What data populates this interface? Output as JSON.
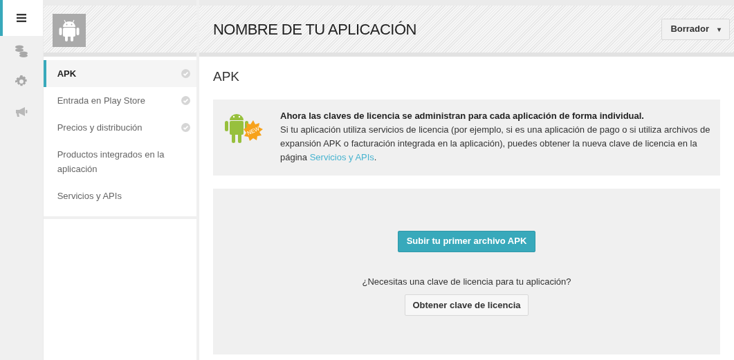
{
  "rail": [
    {
      "selected": true
    },
    {
      "selected": false
    },
    {
      "selected": false
    },
    {
      "selected": false
    }
  ],
  "nav": {
    "items": [
      {
        "label": "APK",
        "selected": true,
        "completed": true
      },
      {
        "label": "Entrada en Play Store",
        "selected": false,
        "completed": true
      },
      {
        "label": "Precios y distribución",
        "selected": false,
        "completed": true
      },
      {
        "label": "Productos integrados en la aplicación",
        "selected": false,
        "completed": false
      },
      {
        "label": "Servicios y APIs",
        "selected": false,
        "completed": false
      }
    ]
  },
  "header": {
    "title": "NOMBRE DE TU APLICACIÓN",
    "status_button": "Borrador",
    "caret": "▾"
  },
  "section_title": "APK",
  "notice": {
    "badge": "NEW",
    "heading": "Ahora las claves de licencia se administran para cada aplicación de forma individual.",
    "body": "Si tu aplicación utiliza servicios de licencia (por ejemplo, si es una aplicación de pago o si utiliza archivos de expansión APK o facturación integrada en la aplicación), puedes obtener la nueva clave de licencia en la página ",
    "link": "Servicios y APIs",
    "after": "."
  },
  "upload": {
    "primary_button": "Subir tu primer archivo APK",
    "question": "¿Necesitas una clave de licencia para tu aplicación?",
    "secondary_button": "Obtener clave de licencia"
  }
}
